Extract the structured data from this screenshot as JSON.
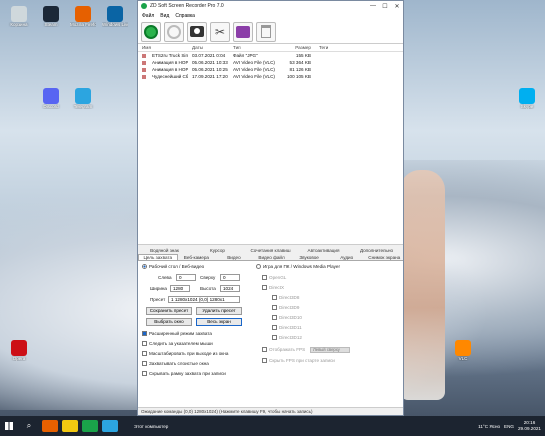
{
  "window": {
    "title": "ZD Soft Screen Recorder Pro 7.0",
    "controls": [
      "—",
      "☐",
      "✕"
    ]
  },
  "menu": [
    "Файл",
    "Вид",
    "Справка"
  ],
  "file_list": {
    "columns": [
      "Имя",
      "Даты",
      "Тип",
      "Размер",
      "Теги"
    ],
    "rows": [
      {
        "name": "ETS2ru Truck Simulat...",
        "date": "03.07.2021 0:04",
        "type": "Файл \"JPG\"",
        "size": "155 KB",
        "tags": ""
      },
      {
        "name": "Анимация в НОРМЕ 2",
        "date": "05.06.2021 10:33",
        "type": "AVI Video File (VLC)",
        "size": "53 364 KB",
        "tags": ""
      },
      {
        "name": "Анимация в НОРМЕ",
        "date": "05.06.2021 10:25",
        "type": "AVI Video File (VLC)",
        "size": "81 126 KB",
        "tags": ""
      },
      {
        "name": "Чудеснейший Сбои",
        "date": "17.09.2021 17:20",
        "type": "AVI Video File (VLC)",
        "size": "100 105 KB",
        "tags": ""
      }
    ]
  },
  "tabs_row1": [
    "Водяной знак",
    "Курсор",
    "Сочетания клавиш",
    "Автоактивация",
    "Дополнительно"
  ],
  "tabs_row2": [
    "Цель захвата",
    "Веб-камера",
    "Видео",
    "Видео файл",
    "Звуковое",
    "Аудио",
    "Снимок экрана"
  ],
  "capture": {
    "mode_desktop": "Рабочий стол / Веб-видео",
    "left_label": "Слева",
    "left_value": "0",
    "top_label": "Сверху",
    "top_value": "0",
    "width_label": "Ширина",
    "width_value": "1280",
    "height_label": "Высота",
    "height_value": "1024",
    "preset_label": "Пресет",
    "preset_value": "1 1280x1024 (0,0) 1280x1",
    "save_preset": "Сохранить пресет",
    "delete_preset": "Удалить пресет",
    "select_window": "Выбрать окно",
    "whole_screen": "Весь экран",
    "checks": [
      {
        "label": "Расширенный режим захвата",
        "checked": true
      },
      {
        "label": "Следить за указателем мыши",
        "checked": false
      },
      {
        "label": "Масштабировать при выходе из окна",
        "checked": false
      },
      {
        "label": "Захватывать слоистые окна",
        "checked": false
      },
      {
        "label": "Скрывать рамку захвата при записи",
        "checked": false
      }
    ],
    "mode_games": "Игра для ПК / Windows Media Player",
    "api_items": [
      "OpenGL",
      "DirectX",
      "Direct3D8",
      "Direct3D9",
      "Direct3D10",
      "Direct3D11",
      "Direct3D12"
    ],
    "show_fps": "Отображать FPS",
    "fps_value": "Левый сверху",
    "hide_fps": "Скрыть FPS при старте записи"
  },
  "status_text": "Ожидание команды (0,0) 1280x1024) (Нажмите клавишу F9, чтобы начать запись)",
  "taskbar": {
    "weather": "11°C Ясно",
    "computer": "Этот компьютер",
    "lang": "ENG",
    "time": "20:16",
    "date": "29.09.2021"
  },
  "desktop_icons": [
    {
      "label": "Корзина",
      "color": "#cfd8dc"
    },
    {
      "label": "Steam",
      "color": "#1b2838"
    },
    {
      "label": "Mozilla Firefox",
      "color": "#e66000"
    },
    {
      "label": "Windows Live",
      "color": "#0a64a4"
    },
    {
      "label": "Telegram",
      "color": "#2ca5e0"
    },
    {
      "label": "Discord",
      "color": "#5865f2"
    },
    {
      "label": "Skype",
      "color": "#00aff0"
    },
    {
      "label": "VLC",
      "color": "#ff8800"
    },
    {
      "label": "Opera",
      "color": "#cc0f16"
    }
  ]
}
